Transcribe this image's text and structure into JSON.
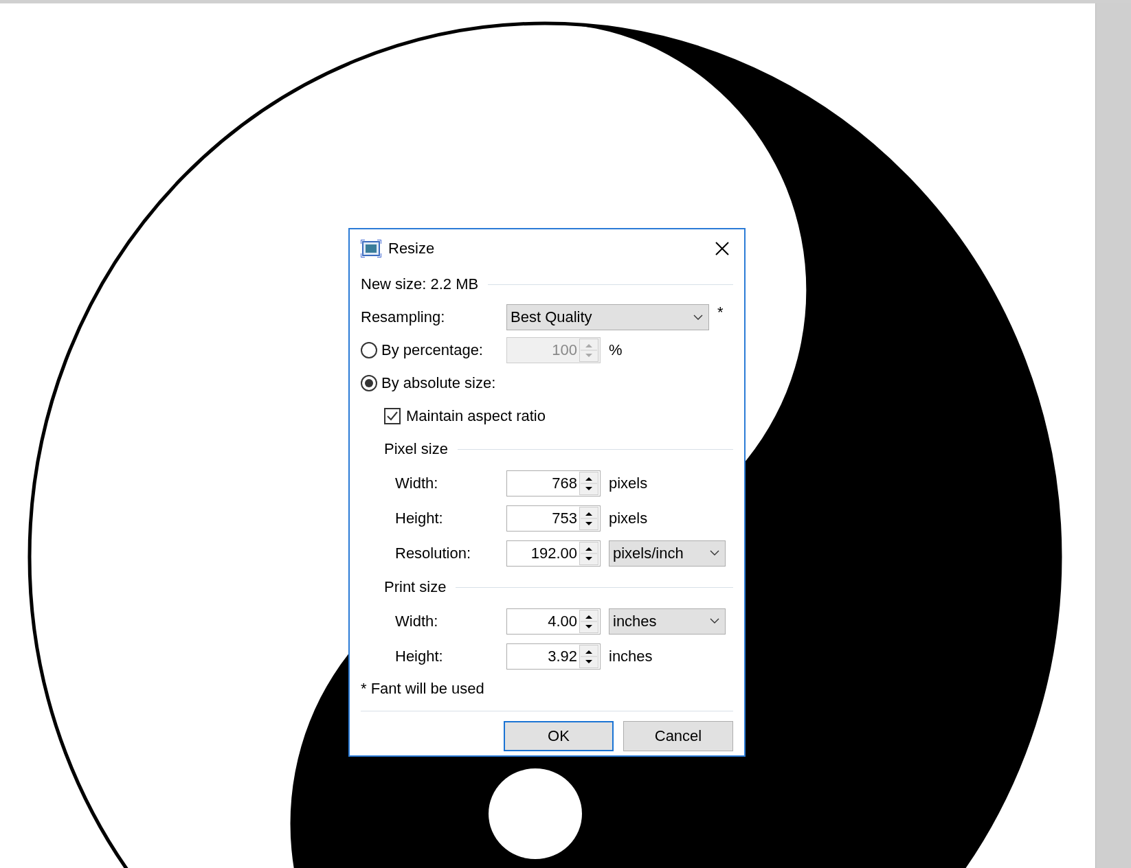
{
  "dialog": {
    "title": "Resize",
    "new_size": "New size: 2.2 MB",
    "resampling": {
      "label": "Resampling:",
      "value": "Best Quality",
      "note": "*"
    },
    "modes": [
      {
        "label": "By percentage:",
        "selected": false,
        "field": {
          "value": "100",
          "unit": "%",
          "disabled": true
        }
      },
      {
        "label": "By absolute size:",
        "selected": true
      }
    ],
    "maintain_aspect": {
      "label": "Maintain aspect ratio",
      "checked": true
    },
    "groups": [
      {
        "title": "Pixel size",
        "fields": [
          {
            "label": "Width:",
            "value": "768",
            "unit": "pixels",
            "kind": "text"
          },
          {
            "label": "Height:",
            "value": "753",
            "unit": "pixels",
            "kind": "text"
          },
          {
            "label": "Resolution:",
            "value": "192.00",
            "unit": "pixels/inch",
            "kind": "dropdown"
          }
        ]
      },
      {
        "title": "Print size",
        "fields": [
          {
            "label": "Width:",
            "value": "4.00",
            "unit": "inches",
            "kind": "dropdown"
          },
          {
            "label": "Height:",
            "value": "3.92",
            "unit": "inches",
            "kind": "text"
          }
        ]
      }
    ],
    "footnote": "* Fant will be used",
    "buttons": [
      {
        "label": "OK",
        "default": true
      },
      {
        "label": "Cancel",
        "default": false
      }
    ]
  }
}
